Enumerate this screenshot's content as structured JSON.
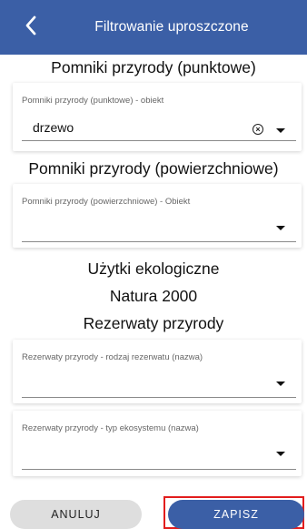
{
  "header": {
    "title": "Filtrowanie uproszczone",
    "back_icon": "chevron-left-icon"
  },
  "sections": {
    "punktowe_heading": "Pomniki przyrody (punktowe)",
    "powierzchniowe_heading": "Pomniki przyrody (powierzchniowe)",
    "uzytki_heading": "Użytki ekologiczne",
    "natura_heading": "Natura 2000",
    "rezerwaty_heading": "Rezerwaty przyrody"
  },
  "fields": {
    "punktowe": {
      "label": "Pomniki przyrody (punktowe) - obiekt",
      "value": "drzewo"
    },
    "powierzchniowe": {
      "label": "Pomniki przyrody (powierzchniowe) - Obiekt",
      "value": ""
    },
    "rodzaj": {
      "label": "Rezerwaty przyrody - rodzaj rezerwatu (nazwa)",
      "value": ""
    },
    "typ": {
      "label": "Rezerwaty przyrody - typ ekosystemu (nazwa)",
      "value": ""
    }
  },
  "buttons": {
    "cancel": "ANULUJ",
    "save": "ZAPISZ"
  },
  "colors": {
    "header_bg": "#3b5fa6",
    "save_bg": "#3b5fa6",
    "cancel_bg": "#dedede",
    "highlight": "#e21d1d"
  }
}
